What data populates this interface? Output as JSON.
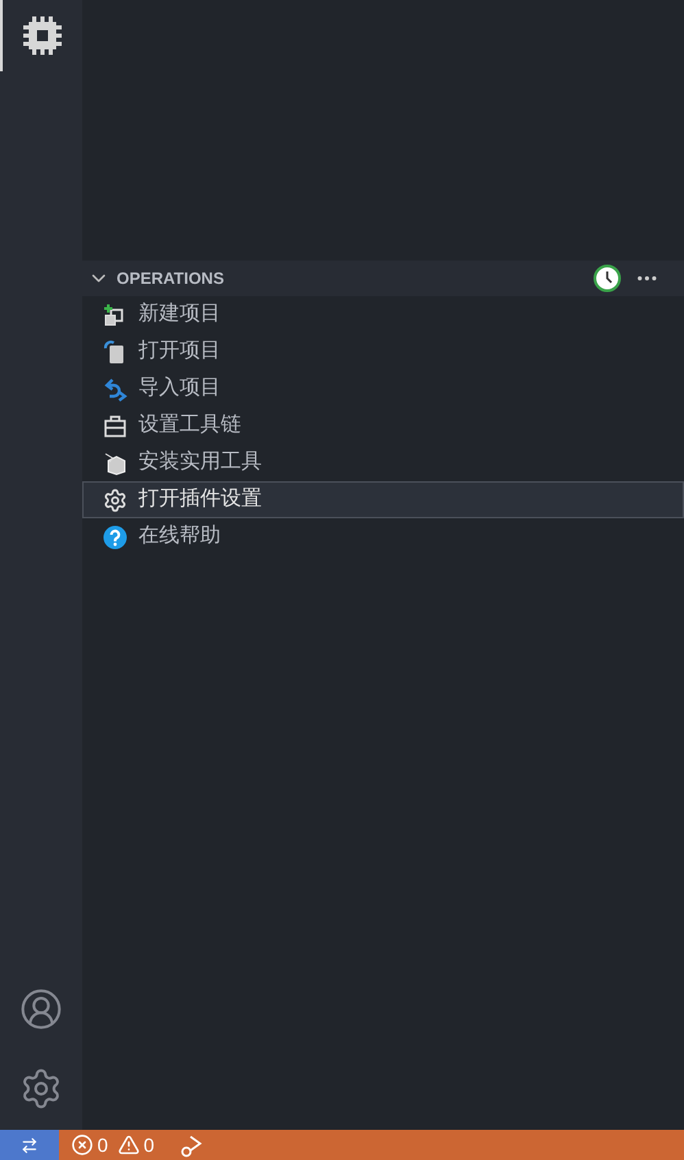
{
  "activity_bar": {
    "items": [
      {
        "kind": "chip",
        "selected": true
      }
    ],
    "bottom": [
      {
        "kind": "account"
      },
      {
        "kind": "manage"
      }
    ]
  },
  "section": {
    "title": "OPERATIONS",
    "expanded": true
  },
  "items": [
    {
      "label": "新建项目",
      "kind": "new",
      "selected": false
    },
    {
      "label": "打开项目",
      "kind": "open",
      "selected": false
    },
    {
      "label": "导入项目",
      "kind": "import",
      "selected": false
    },
    {
      "label": "设置工具链",
      "kind": "toolchain",
      "selected": false
    },
    {
      "label": "安装实用工具",
      "kind": "install",
      "selected": false
    },
    {
      "label": "打开插件设置",
      "kind": "settings",
      "selected": true
    },
    {
      "label": "在线帮助",
      "kind": "help",
      "selected": false
    }
  ],
  "status_bar": {
    "errors": "0",
    "warnings": "0"
  }
}
